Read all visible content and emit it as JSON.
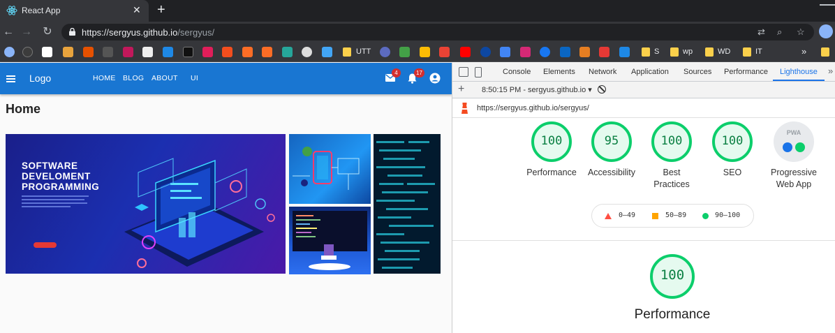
{
  "browser": {
    "tab_title": "React App",
    "tab_close": "✕",
    "new_tab": "+",
    "url_host": "https://sergyus.github.io",
    "url_path": "/sergyus/",
    "bookmarks": [
      {
        "label": "UTT"
      },
      {
        "label": "S"
      },
      {
        "label": "wp"
      },
      {
        "label": "WD"
      },
      {
        "label": "IT"
      }
    ],
    "bookmarks_more": "»"
  },
  "app": {
    "logo": "Logo",
    "nav": [
      "HOME",
      "BLOG",
      "ABOUT",
      "UI"
    ],
    "mail_badge": "4",
    "notifications_badge": "17",
    "page_title": "Home",
    "hero": {
      "title_lines": [
        "SOFTWARE",
        "DEVELOMENT",
        "PROGRAMMING"
      ]
    }
  },
  "devtools": {
    "tabs": [
      "Console",
      "Elements",
      "Network",
      "Application",
      "Sources",
      "Performance",
      "Lighthouse"
    ],
    "active_tab": "Lighthouse",
    "more": "»",
    "report_time": "8:50:15 PM - sergyus.github.io",
    "report_url": "https://sergyus.github.io/sergyus/",
    "scores": [
      {
        "value": "100",
        "label": "Performance"
      },
      {
        "value": "95",
        "label": "Accessibility"
      },
      {
        "value": "100",
        "label": "Best Practices"
      },
      {
        "value": "100",
        "label": "SEO"
      }
    ],
    "pwa": {
      "label": "Progressive Web App",
      "badge_text": "PWA"
    },
    "legend": [
      "0–49",
      "50–89",
      "90–100"
    ],
    "main_score": {
      "value": "100",
      "label": "Performance"
    },
    "colors": {
      "pass": "#0cce6b",
      "average": "#ffa400",
      "fail": "#ff4e42"
    }
  }
}
